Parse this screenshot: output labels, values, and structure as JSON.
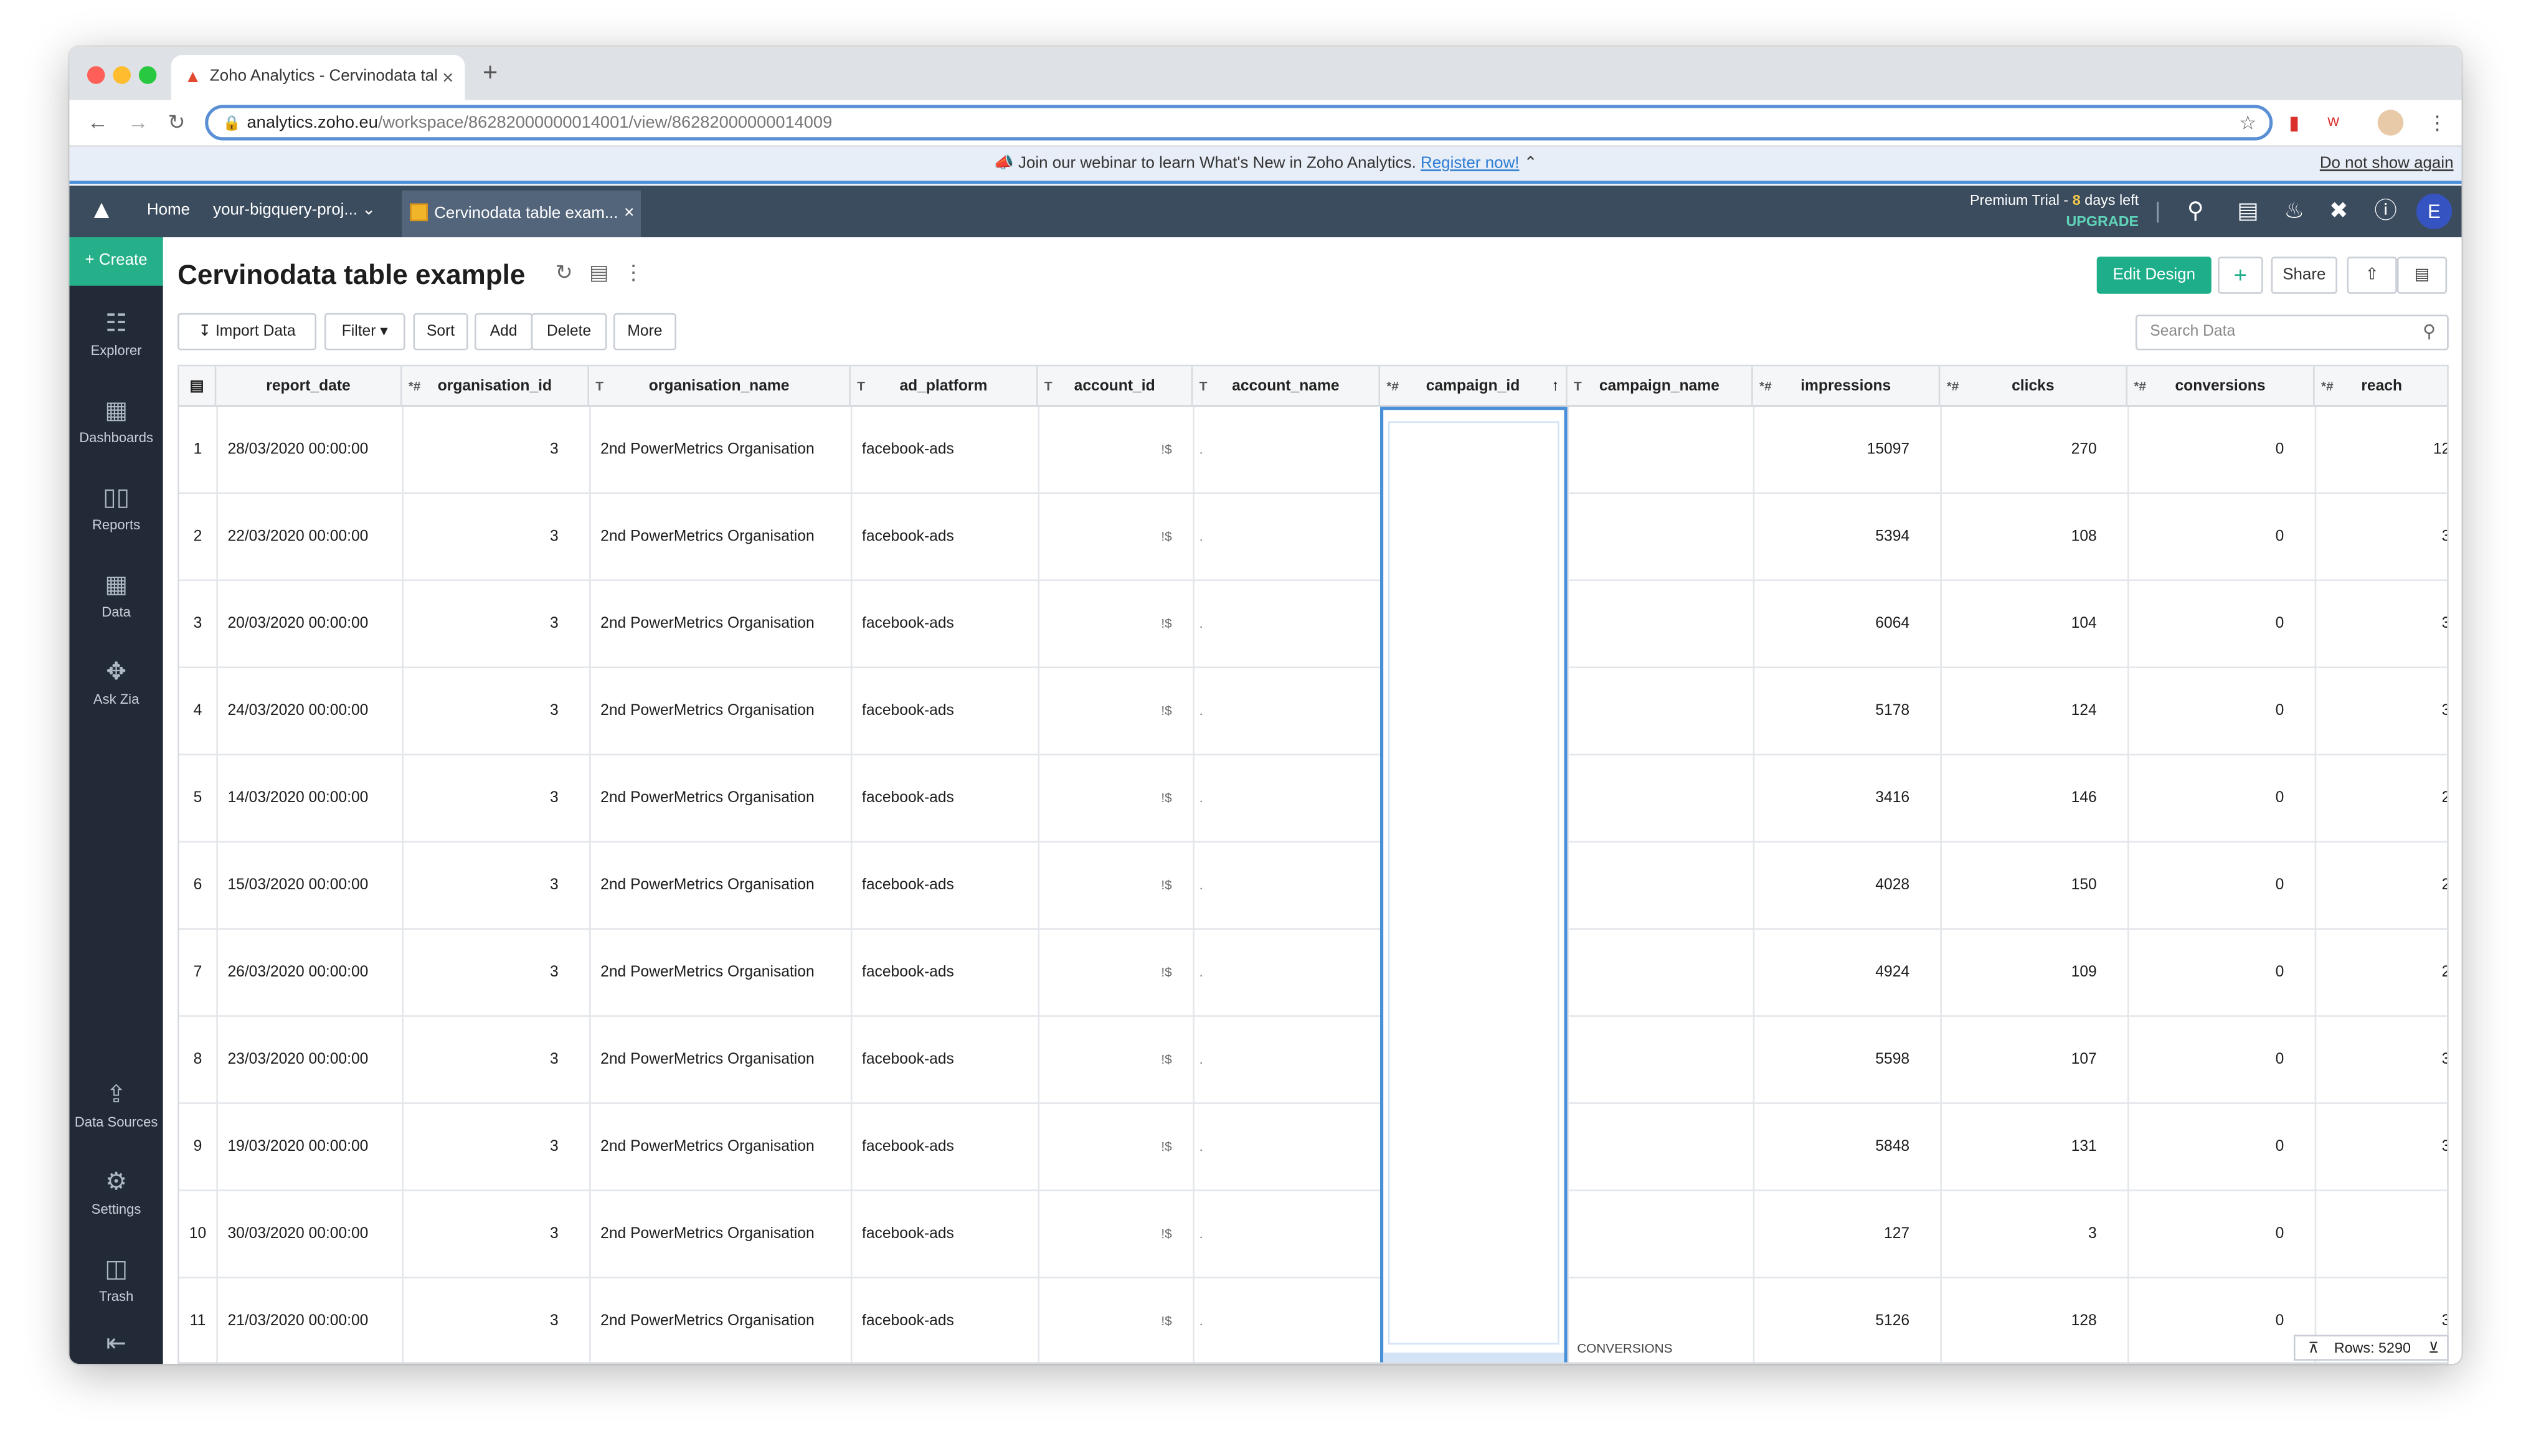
{
  "browser": {
    "tab_title": "Zoho Analytics - Cervinodata tal",
    "url_host": "analytics.zoho.eu",
    "url_path": "/workspace/86282000000014001/view/86282000000014009"
  },
  "banner": {
    "text": "Join our webinar to learn What's New in Zoho Analytics.",
    "link": "Register now!",
    "dismiss": "Do not show again"
  },
  "header": {
    "home": "Home",
    "workspace": "your-bigquery-proj...",
    "view_tab": "Cervinodata table exam...",
    "trial_prefix": "Premium Trial -",
    "trial_days": "8",
    "trial_suffix": "days left",
    "upgrade": "UPGRADE",
    "avatar_letter": "E"
  },
  "sidebar": {
    "create": "Create",
    "items": [
      {
        "label": "Explorer",
        "icon": "explorer-icon"
      },
      {
        "label": "Dashboards",
        "icon": "dashboards-icon"
      },
      {
        "label": "Reports",
        "icon": "reports-icon"
      },
      {
        "label": "Data",
        "icon": "data-icon"
      },
      {
        "label": "Ask Zia",
        "icon": "ask-zia-icon"
      }
    ],
    "bottom_items": [
      {
        "label": "Data Sources",
        "icon": "data-sources-icon"
      },
      {
        "label": "Settings",
        "icon": "settings-icon"
      },
      {
        "label": "Trash",
        "icon": "trash-icon"
      }
    ]
  },
  "page": {
    "title": "Cervinodata table example",
    "edit_design": "Edit Design",
    "share": "Share"
  },
  "toolbar": {
    "import": "Import Data",
    "filter": "Filter",
    "sort": "Sort",
    "add": "Add",
    "delete": "Delete",
    "more": "More",
    "search_placeholder": "Search Data"
  },
  "table": {
    "columns": [
      {
        "name": "report_date",
        "type": ""
      },
      {
        "name": "organisation_id",
        "type": "*#"
      },
      {
        "name": "organisation_name",
        "type": "T"
      },
      {
        "name": "ad_platform",
        "type": "T"
      },
      {
        "name": "account_id",
        "type": "T"
      },
      {
        "name": "account_name",
        "type": "T"
      },
      {
        "name": "campaign_id",
        "type": "*#"
      },
      {
        "name": "campaign_name",
        "type": "T"
      },
      {
        "name": "impressions",
        "type": "*#"
      },
      {
        "name": "clicks",
        "type": "*#"
      },
      {
        "name": "conversions",
        "type": "*#"
      },
      {
        "name": "reach",
        "type": "*#"
      }
    ],
    "rows": [
      {
        "n": "1",
        "date": "28/03/2020 00:00:00",
        "org_id": "3",
        "org": "2nd PowerMetrics Organisation",
        "platform": "facebook-ads",
        "acct_frag": "!$",
        "name_frag": ".",
        "impr": "15097",
        "clicks": "270",
        "conv": "0",
        "reach": "12"
      },
      {
        "n": "2",
        "date": "22/03/2020 00:00:00",
        "org_id": "3",
        "org": "2nd PowerMetrics Organisation",
        "platform": "facebook-ads",
        "acct_frag": "!$",
        "name_frag": ".",
        "impr": "5394",
        "clicks": "108",
        "conv": "0",
        "reach": "3"
      },
      {
        "n": "3",
        "date": "20/03/2020 00:00:00",
        "org_id": "3",
        "org": "2nd PowerMetrics Organisation",
        "platform": "facebook-ads",
        "acct_frag": "!$",
        "name_frag": ".",
        "impr": "6064",
        "clicks": "104",
        "conv": "0",
        "reach": "3"
      },
      {
        "n": "4",
        "date": "24/03/2020 00:00:00",
        "org_id": "3",
        "org": "2nd PowerMetrics Organisation",
        "platform": "facebook-ads",
        "acct_frag": "!$",
        "name_frag": ".",
        "impr": "5178",
        "clicks": "124",
        "conv": "0",
        "reach": "3"
      },
      {
        "n": "5",
        "date": "14/03/2020 00:00:00",
        "org_id": "3",
        "org": "2nd PowerMetrics Organisation",
        "platform": "facebook-ads",
        "acct_frag": "!$",
        "name_frag": ".",
        "impr": "3416",
        "clicks": "146",
        "conv": "0",
        "reach": "2"
      },
      {
        "n": "6",
        "date": "15/03/2020 00:00:00",
        "org_id": "3",
        "org": "2nd PowerMetrics Organisation",
        "platform": "facebook-ads",
        "acct_frag": "!$",
        "name_frag": ".",
        "impr": "4028",
        "clicks": "150",
        "conv": "0",
        "reach": "2"
      },
      {
        "n": "7",
        "date": "26/03/2020 00:00:00",
        "org_id": "3",
        "org": "2nd PowerMetrics Organisation",
        "platform": "facebook-ads",
        "acct_frag": "!$",
        "name_frag": ".",
        "impr": "4924",
        "clicks": "109",
        "conv": "0",
        "reach": "2"
      },
      {
        "n": "8",
        "date": "23/03/2020 00:00:00",
        "org_id": "3",
        "org": "2nd PowerMetrics Organisation",
        "platform": "facebook-ads",
        "acct_frag": "!$",
        "name_frag": ".",
        "impr": "5598",
        "clicks": "107",
        "conv": "0",
        "reach": "3"
      },
      {
        "n": "9",
        "date": "19/03/2020 00:00:00",
        "org_id": "3",
        "org": "2nd PowerMetrics Organisation",
        "platform": "facebook-ads",
        "acct_frag": "!$",
        "name_frag": ".",
        "impr": "5848",
        "clicks": "131",
        "conv": "0",
        "reach": "3"
      },
      {
        "n": "10",
        "date": "30/03/2020 00:00:00",
        "org_id": "3",
        "org": "2nd PowerMetrics Organisation",
        "platform": "facebook-ads",
        "acct_frag": "!$",
        "name_frag": ".",
        "impr": "127",
        "clicks": "3",
        "conv": "0",
        "reach": ""
      },
      {
        "n": "11",
        "date": "21/03/2020 00:00:00",
        "org_id": "3",
        "org": "2nd PowerMetrics Organisation",
        "platform": "facebook-ads",
        "acct_frag": "!$",
        "name_frag": ".",
        "impr": "5126",
        "clicks": "128",
        "conv": "0",
        "reach": "3"
      }
    ],
    "overflow_text": "CONVERSIONS",
    "rows_count": "Rows: 5290"
  },
  "colors": {
    "accent": "#1eae8a",
    "header_bg": "#3b4c5f",
    "sidebar_bg": "#222a37",
    "selection": "#4a90d9"
  }
}
